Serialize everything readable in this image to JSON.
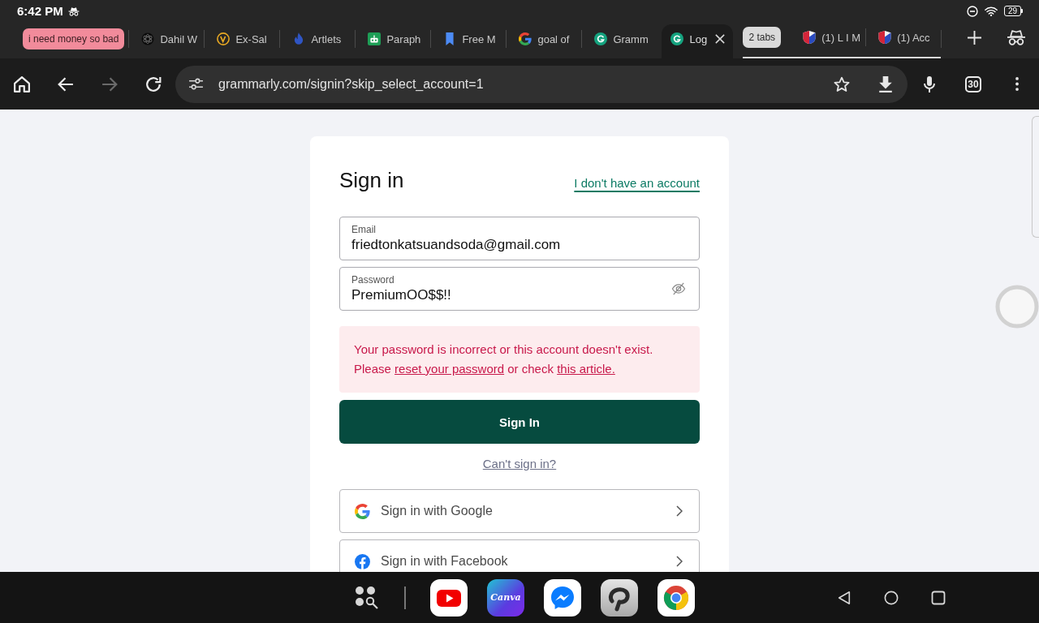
{
  "status_bar": {
    "time": "6:42 PM",
    "battery": "29"
  },
  "tab_strip": {
    "items": [
      {
        "kind": "group",
        "label": "i need money so bad",
        "color": "#f28b9b",
        "expanded": false
      },
      {
        "kind": "tab",
        "title": "Dahil W",
        "selected": false
      },
      {
        "kind": "tab",
        "title": "Ex-Sal",
        "selected": false
      },
      {
        "kind": "tab",
        "title": "Artlets",
        "selected": false
      },
      {
        "kind": "tab",
        "title": "Paraph",
        "selected": false
      },
      {
        "kind": "tab",
        "title": "Free M",
        "selected": false
      },
      {
        "kind": "tab",
        "title": "goal of",
        "selected": false
      },
      {
        "kind": "tab",
        "title": "Gramm",
        "selected": false
      },
      {
        "kind": "tab",
        "title": "Log",
        "selected": true
      },
      {
        "kind": "group",
        "label": "2 tabs",
        "color": "#dadada",
        "expanded": true,
        "tabs": [
          {
            "title": "(1) L I M",
            "selected": false
          },
          {
            "title": "(1) Acc",
            "selected": false
          }
        ]
      }
    ]
  },
  "toolbar": {
    "nav": [
      {
        "kind": "home",
        "disabled": false
      },
      {
        "kind": "back",
        "disabled": false
      },
      {
        "kind": "forward",
        "disabled": true
      },
      {
        "kind": "reload",
        "disabled": false
      }
    ],
    "url": "grammarly.com/signin?skip_select_account=1",
    "tab_count": "30"
  },
  "signin": {
    "title": "Sign in",
    "signup_link": "I don't have an account",
    "fields": [
      {
        "kind": "text",
        "label": "Email",
        "value": "friedtonkatsuandsoda@gmail.com"
      },
      {
        "kind": "password",
        "label": "Password",
        "value": "PremiumOO$$!!"
      }
    ],
    "error": [
      {
        "text": "Your password is incorrect or this account doesn't exist. Please ",
        "link": false
      },
      {
        "text": "reset your password",
        "link": true
      },
      {
        "text": " or check ",
        "link": false
      },
      {
        "text": "this article.",
        "link": true
      }
    ],
    "submit": "Sign In",
    "help_link": "Can't sign in?",
    "providers": [
      {
        "kind": "google",
        "label": "Sign in with Google"
      },
      {
        "kind": "facebook",
        "label": "Sign in with Facebook"
      }
    ]
  },
  "taskbar": {
    "apps": [
      {
        "kind": "youtube"
      },
      {
        "kind": "canva",
        "label": "Canva"
      },
      {
        "kind": "messenger"
      },
      {
        "kind": "clip-studio"
      },
      {
        "kind": "chrome"
      }
    ]
  }
}
